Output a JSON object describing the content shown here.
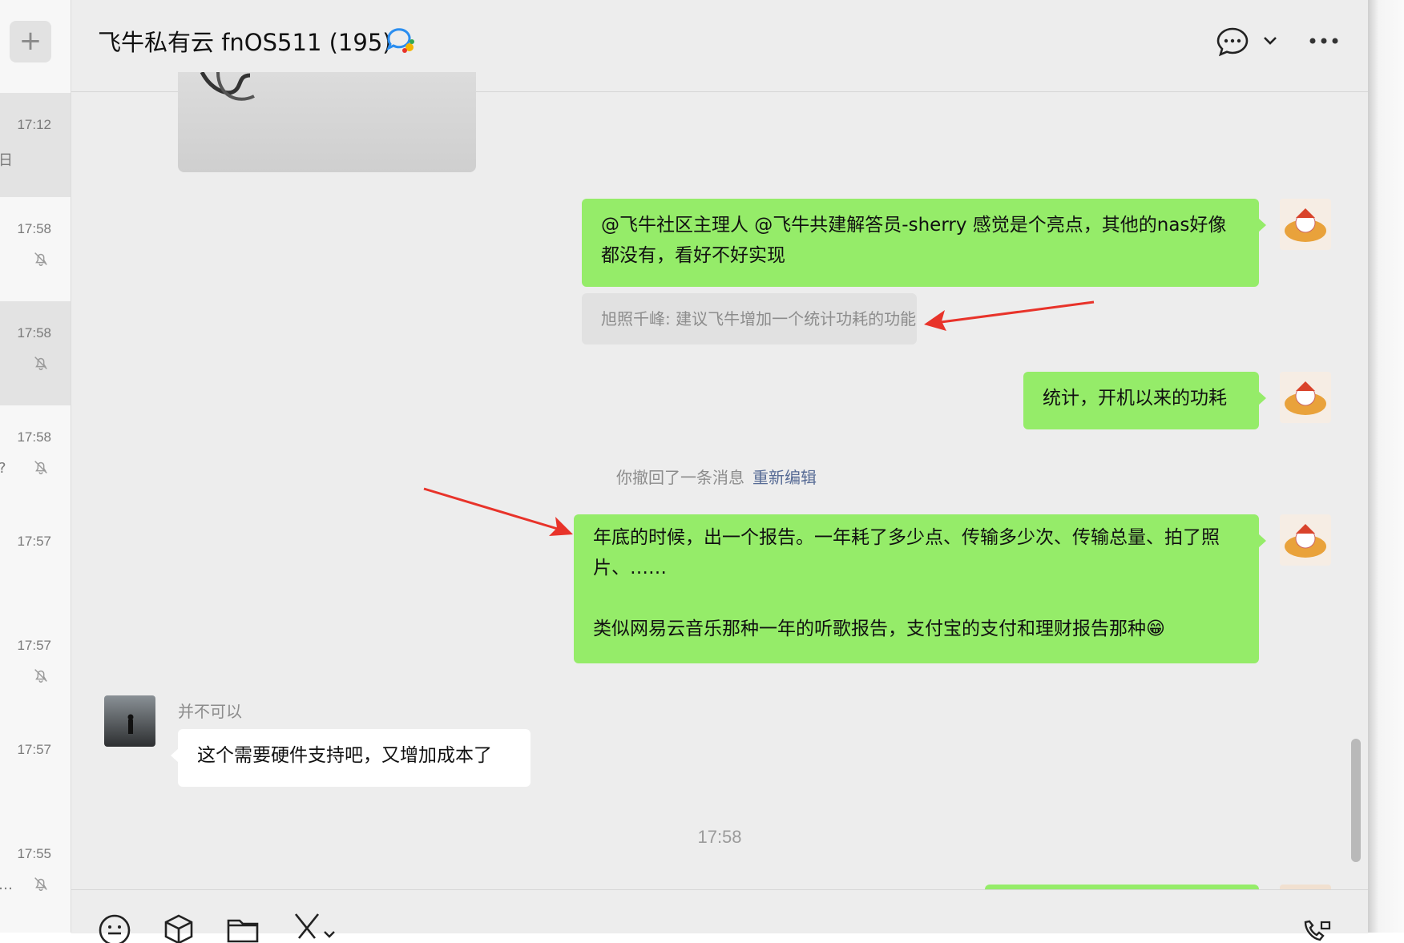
{
  "sidebar": {
    "add_label": "+",
    "conversations": [
      {
        "time": "17:12",
        "snippet": "日",
        "muted": false,
        "selected": true
      },
      {
        "time": "17:58",
        "snippet": "",
        "muted": true,
        "selected": false
      },
      {
        "time": "17:58",
        "snippet": "",
        "muted": true,
        "selected": true
      },
      {
        "time": "17:58",
        "snippet": "?",
        "muted": true,
        "selected": false
      },
      {
        "time": "17:57",
        "snippet": "",
        "muted": false,
        "selected": false
      },
      {
        "time": "17:57",
        "snippet": "",
        "muted": true,
        "selected": false
      },
      {
        "time": "17:57",
        "snippet": "",
        "muted": false,
        "selected": false
      },
      {
        "time": "17:55",
        "snippet": "…",
        "muted": true,
        "selected": false
      }
    ]
  },
  "header": {
    "title": "飞牛私有云 fnOS511 (195)"
  },
  "messages": {
    "m1": "@飞牛社区主理人 @飞牛共建解答员-sherry 感觉是个亮点，其他的nas好像都没有，看好不好实现",
    "quote": "旭照千峰: 建议飞牛增加一个统计功耗的功能",
    "m2": "统计，开机以来的功耗",
    "recall_text": "你撤回了一条消息",
    "recall_link": "重新编辑",
    "m3_line1": "年底的时候，出一个报告。一年耗了多少点、传输多少次、传输总量、拍了照片、……",
    "m3_line2": "类似网易云音乐那种一年的听歌报告，支付宝的支付和理财报告那种😁",
    "sender_name": "并不可以",
    "m4": "这个需要硬件支持吧，又增加成本了",
    "time_separator": "17:58"
  },
  "colors": {
    "bubble_self": "#95ec69",
    "bubble_other": "#ffffff",
    "link": "#576b95",
    "annotation_arrow": "#e8332a"
  }
}
